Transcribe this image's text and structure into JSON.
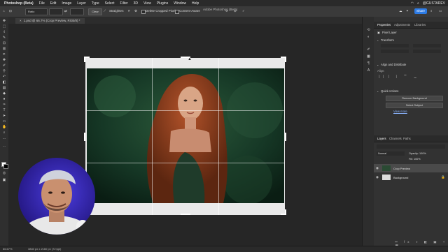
{
  "menubar": {
    "items": [
      "Photoshop (Beta)",
      "File",
      "Edit",
      "Image",
      "Layer",
      "Type",
      "Select",
      "Filter",
      "3D",
      "View",
      "Plugins",
      "Window",
      "Help"
    ],
    "right": [
      "@GUSTAREV"
    ]
  },
  "options": {
    "ratio_label": "Ratio",
    "clear_label": "Clear",
    "straighten_label": "Straighten",
    "delete_cropped": "Delete Cropped Pixels",
    "content_aware": "Content-Aware",
    "window_title": "Adobe Photoshop (Beta)",
    "share_label": "Share"
  },
  "document": {
    "tab_label": "1.psd @ 66.7% (Crop Preview, RGB/8) *"
  },
  "panels": {
    "top_tabs": [
      "Properties",
      "Adjustments",
      "Libraries"
    ],
    "pixel_layer": "Pixel Layer",
    "transform": "Transform",
    "align": "Align and Distribute",
    "align_sub": "Align:",
    "quick_actions": "Quick Actions",
    "remove_bg": "Remove Background",
    "select_subject": "Select Subject",
    "view_more": "View more",
    "layer_tabs": [
      "Layers",
      "Channels",
      "Paths"
    ],
    "kind": "Normal",
    "opacity": "Opacity: 100%",
    "fill": "Fill: 100%",
    "layers": [
      {
        "name": "Crop Preview"
      },
      {
        "name": "Background"
      }
    ]
  },
  "status": {
    "zoom": "66.67%",
    "info": "3840 px x 2160 px (72 ppi)"
  },
  "colors": {
    "share": "#2d7be5",
    "accent_bg": "#1e1e1e"
  }
}
